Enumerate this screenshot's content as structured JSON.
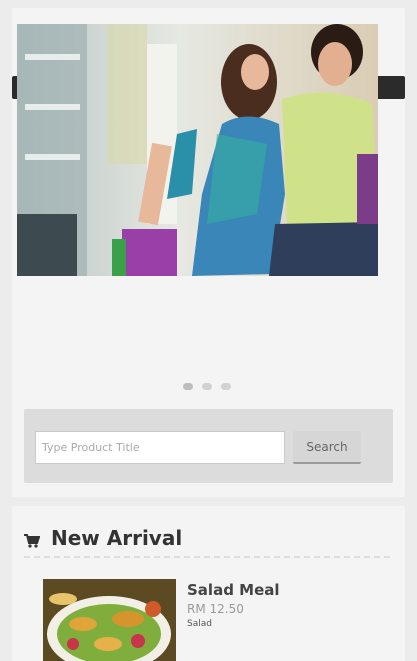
{
  "search": {
    "placeholder": "Type Product Title",
    "button_label": "Search"
  },
  "slider": {
    "slide_count": 3,
    "active_index": 0
  },
  "new_arrival": {
    "title": "New Arrival",
    "icon": "cart-icon",
    "products": [
      {
        "name": "Salad Meal",
        "price": "RM 12.50",
        "category": "Salad"
      }
    ]
  },
  "colors": {
    "background": "#ececec",
    "panel": "#f4f4f4",
    "dark_bar": "#2b2b2b",
    "search_area": "#dcdcdc"
  }
}
